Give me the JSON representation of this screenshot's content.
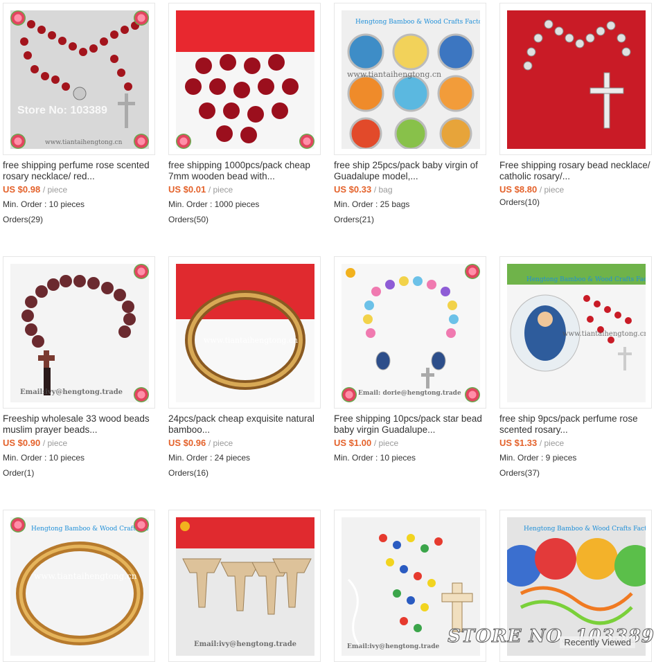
{
  "products": [
    {
      "title": "free shipping perfume rose scented rosary necklace/ red...",
      "price": "US $0.98",
      "unit": "/ piece",
      "min_order": "Min. Order : 10 pieces",
      "orders": "Orders(29)",
      "watermark": "Store No: 103389",
      "watermark2": "www.tiantaihengtong.cn"
    },
    {
      "title": "free shipping 1000pcs/pack cheap 7mm wooden bead with...",
      "price": "US $0.01",
      "unit": "/ piece",
      "min_order": "Min. Order : 1000 pieces",
      "orders": "Orders(50)"
    },
    {
      "title": "free ship 25pcs/pack baby virgin of Guadalupe model,...",
      "price": "US $0.33",
      "unit": "/ bag",
      "min_order": "Min. Order : 25 bags",
      "orders": "Orders(21)",
      "watermark": "Hengtong Bamboo & Wood Crafts Factory",
      "watermark2": "www.tiantaihengtong.cn"
    },
    {
      "title": "Free shipping rosary bead necklace/ catholic rosary/...",
      "price": "US $8.80",
      "unit": "/ piece",
      "orders": "Orders(10)"
    },
    {
      "title": "Freeship wholesale 33 wood beads muslim prayer beads...",
      "price": "US $0.90",
      "unit": "/ piece",
      "min_order": "Min. Order : 10 pieces",
      "orders": "Order(1)",
      "watermark": "Email:ivy@hengtong.trade"
    },
    {
      "title": "24pcs/pack cheap exquisite natural bamboo...",
      "price": "US $0.96",
      "unit": "/ piece",
      "min_order": "Min. Order : 24 pieces",
      "orders": "Orders(16)",
      "watermark": "www.tiantaihengtong.cn"
    },
    {
      "title": "Free shipping 10pcs/pack star bead baby virgin Guadalupe...",
      "price": "US $1.00",
      "unit": "/ piece",
      "min_order": "Min. Order : 10 pieces",
      "watermark": "Email: dorie@hengtong.trade"
    },
    {
      "title": "free ship 9pcs/pack perfume rose scented rosary...",
      "price": "US $1.33",
      "unit": "/ piece",
      "min_order": "Min. Order : 9 pieces",
      "orders": "Orders(37)",
      "watermark": "Hengtong Bamboo & Wood Crafts Factory",
      "watermark2": "www.tiantaihengtong.cn"
    },
    {
      "watermark": "Hengtong Bamboo & Wood Crafts Factory",
      "watermark2": "www.tiantaihengtong.cn"
    },
    {
      "watermark": "Email:ivy@hengtong.trade"
    },
    {
      "watermark": "Email:ivy@hengtong.trade"
    },
    {
      "watermark": "Hengtong Bamboo & Wood Crafts Factory"
    }
  ],
  "overlay": {
    "store_banner": "STORE NO. 103389",
    "recently_viewed": "Recently Viewed"
  },
  "colors": {
    "price": "#e4622b",
    "border": "#e6e6e6"
  }
}
